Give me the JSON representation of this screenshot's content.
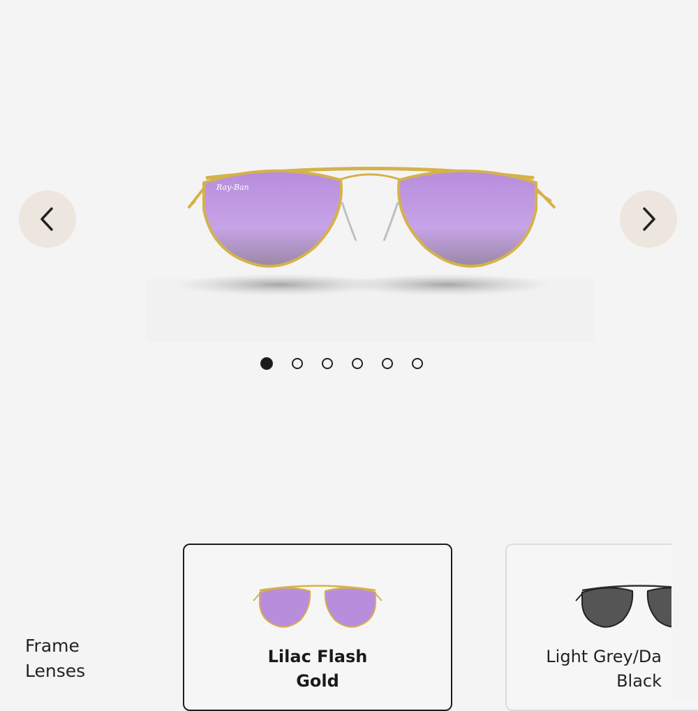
{
  "gallery": {
    "product_image": "sunglasses-lilac-gold",
    "prev_icon": "chevron-left-icon",
    "next_icon": "chevron-right-icon",
    "dots_count": 6,
    "active_dot": 1
  },
  "labels": {
    "frame": "Frame",
    "lenses": "Lenses"
  },
  "variants": [
    {
      "line1": "Lilac Flash",
      "line2": "Gold",
      "selected": true
    },
    {
      "line1": "Light Grey/Da",
      "line2": "Black",
      "selected": false
    }
  ],
  "colors": {
    "background": "#f4f4f4",
    "nav_button": "#ece6df",
    "lens_lilac": "#b58ad8",
    "frame_gold": "#d4b24a",
    "lens_grey": "#555555"
  }
}
